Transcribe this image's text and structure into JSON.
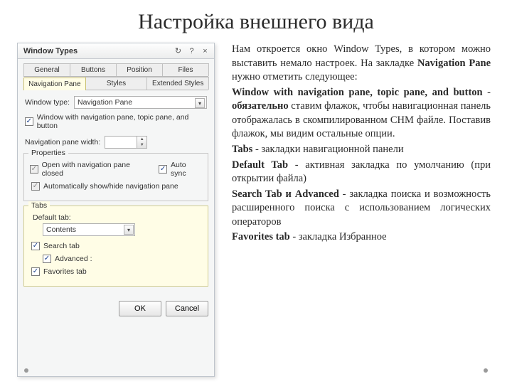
{
  "slide": {
    "title": "Настройка внешнего вида"
  },
  "dialog": {
    "title": "Window Types",
    "tabs_row1": [
      "General",
      "Buttons",
      "Position",
      "Files"
    ],
    "tabs_row2": [
      "Navigation Pane",
      "Styles",
      "Extended Styles"
    ],
    "active_tab": "Navigation Pane",
    "window_type_label": "Window type:",
    "window_type_value": "Navigation Pane",
    "cb_nav_combo": "Window with navigation pane, topic pane, and button",
    "nav_width_label": "Navigation pane width:",
    "properties_legend": "Properties",
    "cb_open_closed": "Open with navigation pane closed",
    "cb_auto_sync": "Auto sync",
    "cb_auto_showhide": "Automatically show/hide navigation pane",
    "tabs_legend": "Tabs",
    "default_tab_label": "Default tab:",
    "default_tab_value": "Contents",
    "cb_search": "Search tab",
    "cb_advanced": "Advanced :",
    "cb_favorites": "Favorites tab",
    "ok": "OK",
    "cancel": "Cancel"
  },
  "text": {
    "p1a": "Нам откроется окно Window Types, в котором можно выставить немало настроек. На закладке ",
    "p1b": "Navigation Pane",
    "p1c": " нужно отметить следующее:",
    "p2a": "Window with navigation pane, topic pane, and button",
    "p2b": " - ",
    "p2c": "обязательно",
    "p2d": " ставим флажок, чтобы навигационная панель отображалась в скомпилированном CHM файле. Поставив флажок, мы видим остальные опции.",
    "p3a": "Tabs",
    "p3b": " - закладки навигационной панели",
    "p4a": "Default Tab",
    "p4b": " - активная закладка по умолчанию (при открытии файла)",
    "p5a": "Search Tab и Advanced",
    "p5b": " - закладка поиска и возможность расширенного поиска с использованием логических операторов",
    "p6a": "Favorites tab",
    "p6b": " - закладка Избранное"
  }
}
